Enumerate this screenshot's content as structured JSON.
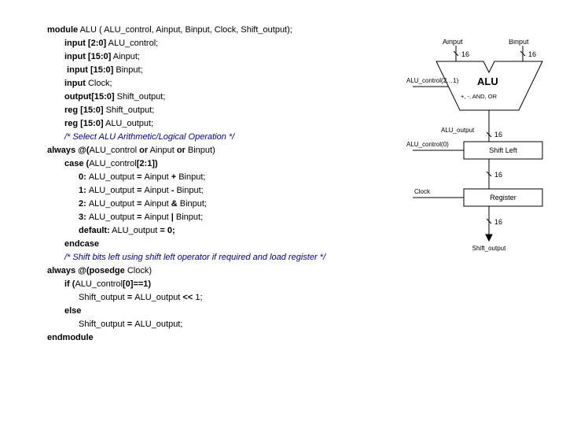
{
  "code": {
    "l1a": "module",
    "l1b": " ALU ( ALU_control, Ainput, Binput, Clock, Shift_output);",
    "l2a": "input [2:0]",
    "l2b": " ALU_control;",
    "l3a": "input [15:0]",
    "l3b": " Ainput;",
    "l4a": " input [15:0]",
    "l4b": " Binput;",
    "l5a": "input",
    "l5b": " Clock;",
    "l6a": "output[15:0]",
    "l6b": " Shift_output;",
    "l7a": "reg [15:0]",
    "l7b": " Shift_output;",
    "l8a": "reg [15:0]",
    "l8b": " ALU_output;",
    "l9": "/* Select ALU Arithmetic/Logical Operation */",
    "l10a": "always @(",
    "l10b": "ALU_control ",
    "l10c": "or",
    "l10d": " Ainput ",
    "l10e": "or",
    "l10f": " Binput)",
    "l11a": "case (",
    "l11b": "ALU_control",
    "l11c": "[2:1])",
    "l12a": "0: ",
    "l12b": "ALU_output ",
    "l12c": "= ",
    "l12d": "Ainput ",
    "l12e": "+ ",
    "l12f": "Binput;",
    "l13a": "1: ",
    "l13b": "ALU_output ",
    "l13c": "= ",
    "l13d": "Ainput ",
    "l13e": "- ",
    "l13f": "Binput;",
    "l14a": "2: ",
    "l14b": "ALU_output ",
    "l14c": "= ",
    "l14d": "Ainput ",
    "l14e": "& ",
    "l14f": "Binput;",
    "l15a": "3: ",
    "l15b": "ALU_output ",
    "l15c": "= ",
    "l15d": "Ainput ",
    "l15e": "| ",
    "l15f": "Binput;",
    "l16a": "default:",
    "l16b": " ALU_output ",
    "l16c": "= 0;",
    "l17": "endcase",
    "l18": "/* Shift bits left using shift left operator if required and load register */",
    "l19a": "always @(posedge",
    "l19b": " Clock)",
    "l20a": "if (",
    "l20b": "ALU_control",
    "l20c": "[0]==1)",
    "l21a": "Shift_output ",
    "l21b": "= ",
    "l21c": "ALU_output ",
    "l21d": "<< ",
    "l21e": "1;",
    "l22": "else",
    "l23a": "Shift_output ",
    "l23b": "= ",
    "l23c": "ALU_output;",
    "l24": "endmodule"
  },
  "diag": {
    "ainput": "Ainput",
    "binput": "Binput",
    "s16a": "16",
    "s16b": "16",
    "alu": "ALU",
    "alu_ctrl": "ALU_control(2…1)",
    "ops": "+, -, AND, OR",
    "alu_out": "ALU_output",
    "s16c": "16",
    "ctrl0": "ALU_control(0)",
    "shiftleft": "Shift Left",
    "s16d": "16",
    "clock": "Clock",
    "register": "Register",
    "s16e": "16",
    "shift_out": "Shift_output"
  }
}
